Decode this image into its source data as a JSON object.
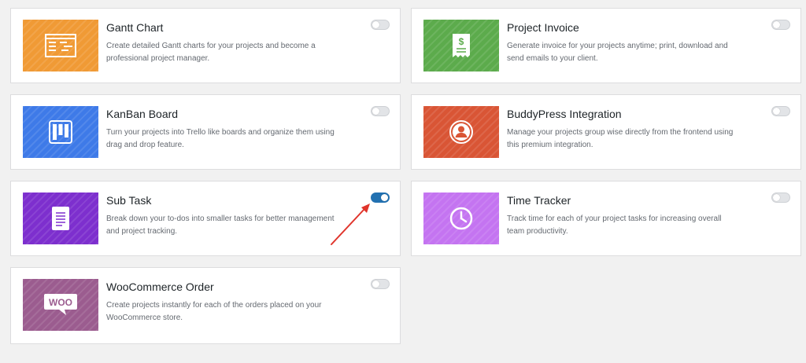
{
  "modules": [
    {
      "title": "Gantt Chart",
      "description": "Create detailed Gantt charts for your projects and become a professional project manager.",
      "enabled": false,
      "color": "#f09a35",
      "icon": "gantt-chart-icon"
    },
    {
      "title": "Project Invoice",
      "description": "Generate invoice for your projects anytime; print, download and send emails to your client.",
      "enabled": false,
      "color": "#5cab4c",
      "icon": "invoice-icon"
    },
    {
      "title": "KanBan Board",
      "description": "Turn your projects into Trello like boards and organize them using drag and drop feature.",
      "enabled": false,
      "color": "#3e7ae8",
      "icon": "kanban-board-icon"
    },
    {
      "title": "BuddyPress Integration",
      "description": "Manage your projects group wise directly from the frontend using this premium integration.",
      "enabled": false,
      "color": "#d95535",
      "icon": "buddypress-icon"
    },
    {
      "title": "Sub Task",
      "description": "Break down your to-dos into smaller tasks for better management and project tracking.",
      "enabled": true,
      "color": "#7d2fce",
      "icon": "subtask-document-icon"
    },
    {
      "title": "Time Tracker",
      "description": "Track time for each of your project tasks for increasing overall team productivity.",
      "enabled": false,
      "color": "#c474f1",
      "icon": "clock-icon"
    },
    {
      "title": "WooCommerce Order",
      "description": "Create projects instantly for each of the orders placed on your WooCommerce store.",
      "enabled": false,
      "color": "#9b5c8f",
      "icon": "woocommerce-icon"
    }
  ],
  "annotation": {
    "color": "#e0342b"
  },
  "woo_logo_text": "WOO"
}
